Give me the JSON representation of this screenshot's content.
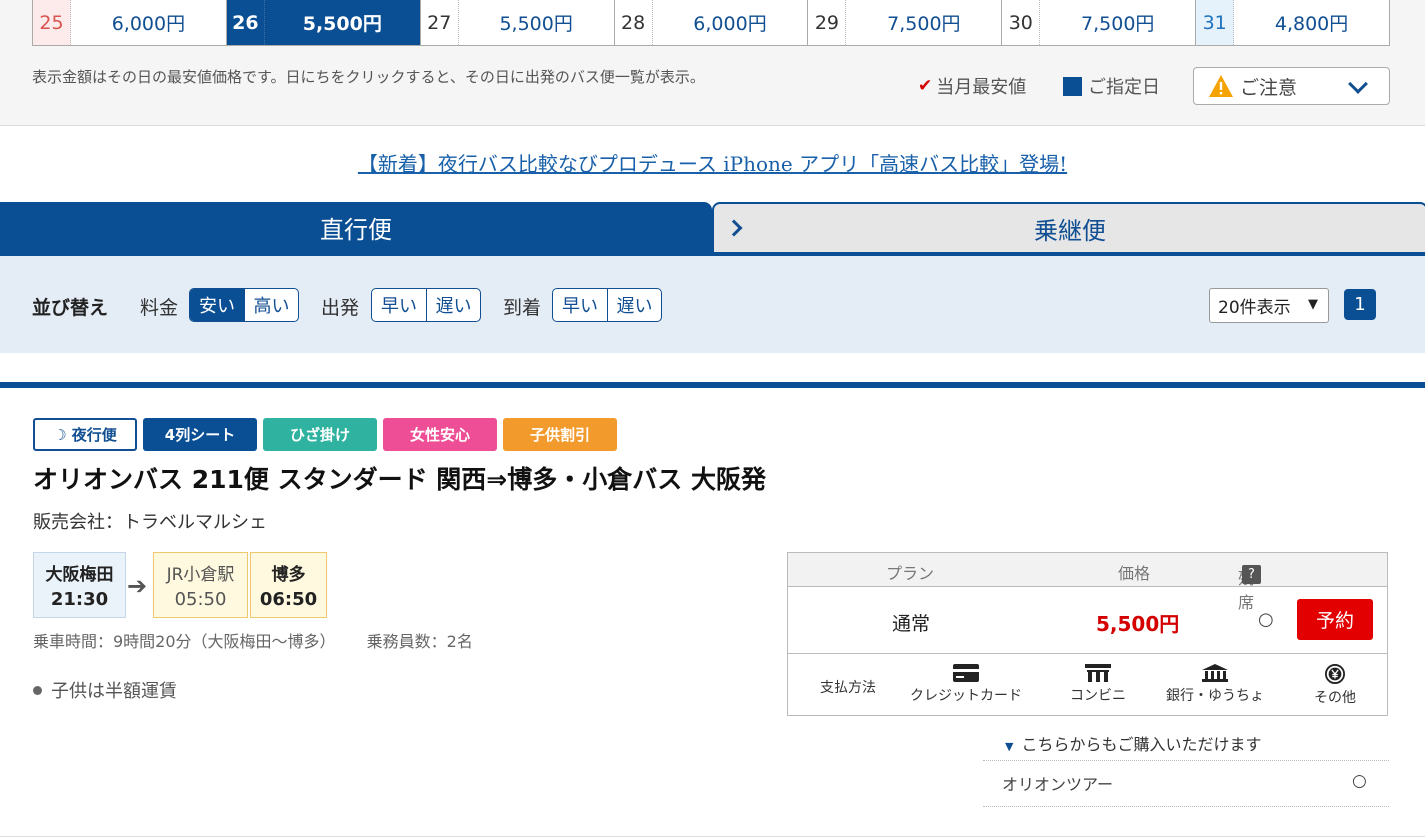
{
  "calendar": {
    "days": [
      {
        "day": "25",
        "price": "6,000円",
        "kind": "sun"
      },
      {
        "day": "26",
        "price": "5,500円",
        "kind": "sel"
      },
      {
        "day": "27",
        "price": "5,500円",
        "kind": ""
      },
      {
        "day": "28",
        "price": "6,000円",
        "kind": ""
      },
      {
        "day": "29",
        "price": "7,500円",
        "kind": ""
      },
      {
        "day": "30",
        "price": "7,500円",
        "kind": ""
      },
      {
        "day": "31",
        "price": "4,800円",
        "kind": "sat"
      }
    ],
    "note": "表示金額はその日の最安値価格です。日にちをクリックすると、その日に出発のバス便一覧が表示。",
    "legend_lowest": "当月最安値",
    "legend_selected": "ご指定日",
    "caution_label": "ご注意",
    "colors": {
      "selected": "#0a4e93",
      "lowest_check": "#d40000"
    }
  },
  "news": {
    "link_text": "【新着】夜行バス比較なびプロデュース iPhone アプリ「高速バス比較」登場!"
  },
  "tabs": {
    "direct": "直行便",
    "transfer": "乗継便"
  },
  "sort": {
    "title": "並び替え",
    "price_label": "料金",
    "price_options": [
      "安い",
      "高い"
    ],
    "depart_label": "出発",
    "depart_options": [
      "早い",
      "遅い"
    ],
    "arrive_label": "到着",
    "arrive_options": [
      "早い",
      "遅い"
    ],
    "per_page": "20件表示",
    "page": "1"
  },
  "bus": {
    "tags": [
      "夜行便",
      "4列シート",
      "ひざ掛け",
      "女性安心",
      "子供割引"
    ],
    "title": "オリオンバス 211便 スタンダード 関西⇒博多・小倉バス 大阪発",
    "seller": "販売会社：トラベルマルシェ",
    "route": {
      "departure": {
        "name": "大阪梅田",
        "time": "21:30"
      },
      "via": {
        "name": "JR小倉駅",
        "time": "05:50"
      },
      "arrival": {
        "name": "博多",
        "time": "06:50"
      }
    },
    "ride_time": "乗車時間：9時間20分（大阪梅田～博多）",
    "crew": "乗務員数：2名",
    "child_note": "子供は半額運賃"
  },
  "plan_table": {
    "headers": {
      "plan": "プラン",
      "price": "価格",
      "seats": "残席",
      "help": "?"
    },
    "row": {
      "name": "通常",
      "price": "5,500円",
      "seats": "○",
      "reserve": "予約"
    },
    "payment_label": "支払方法",
    "payments": [
      {
        "label": "クレジットカード",
        "icon": "credit-card-icon"
      },
      {
        "label": "コンビニ",
        "icon": "convenience-store-icon"
      },
      {
        "label": "銀行・ゆうちょ",
        "icon": "bank-icon"
      },
      {
        "label": "その他",
        "icon": "yen-icon"
      }
    ]
  },
  "other_purchase": {
    "label": "こちらからもご購入いただけます",
    "tour_name": "オリオンツアー",
    "tour_seats": "○"
  }
}
